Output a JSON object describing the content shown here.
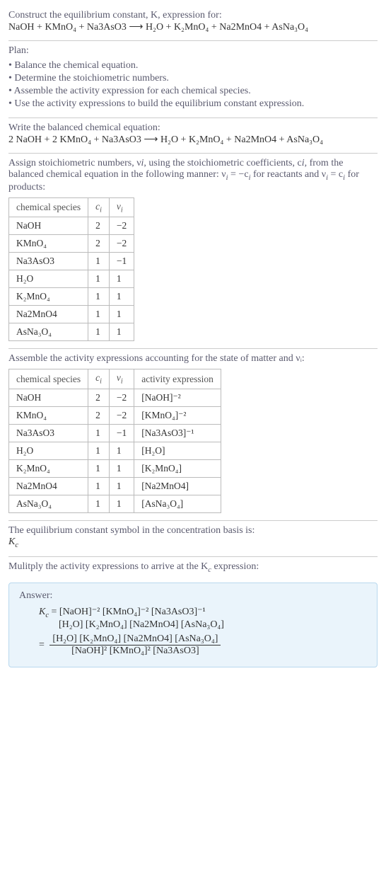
{
  "chart_data": [
    {
      "type": "table",
      "title": "Stoichiometric numbers",
      "columns": [
        "chemical species",
        "c_i",
        "ν_i"
      ],
      "rows": [
        [
          "NaOH",
          2,
          -2
        ],
        [
          "KMnO4",
          2,
          -2
        ],
        [
          "Na3AsO3",
          1,
          -1
        ],
        [
          "H2O",
          1,
          1
        ],
        [
          "K2MnO4",
          1,
          1
        ],
        [
          "Na2MnO4",
          1,
          1
        ],
        [
          "AsNa3O4",
          1,
          1
        ]
      ]
    },
    {
      "type": "table",
      "title": "Activity expressions",
      "columns": [
        "chemical species",
        "c_i",
        "ν_i",
        "activity expression"
      ],
      "rows": [
        [
          "NaOH",
          2,
          -2,
          "[NaOH]^(-2)"
        ],
        [
          "KMnO4",
          2,
          -2,
          "[KMnO4]^(-2)"
        ],
        [
          "Na3AsO3",
          1,
          -1,
          "[Na3AsO3]^(-1)"
        ],
        [
          "H2O",
          1,
          1,
          "[H2O]"
        ],
        [
          "K2MnO4",
          1,
          1,
          "[K2MnO4]"
        ],
        [
          "Na2MnO4",
          1,
          1,
          "[Na2MnO4]"
        ],
        [
          "AsNa3O4",
          1,
          1,
          "[AsNa3O4]"
        ]
      ]
    }
  ],
  "s1": {
    "line1": "Construct the equilibrium constant, K, expression for:",
    "eq": "NaOH + KMnO₄ + Na3AsO3 ⟶ H₂O + K₂MnO₄ + Na2MnO4 + AsNa₃O₄"
  },
  "s2": {
    "title": "Plan:",
    "b1": "• Balance the chemical equation.",
    "b2": "• Determine the stoichiometric numbers.",
    "b3": "• Assemble the activity expression for each chemical species.",
    "b4": "• Use the activity expressions to build the equilibrium constant expression."
  },
  "s3": {
    "title": "Write the balanced chemical equation:",
    "eq": "2 NaOH + 2 KMnO₄ + Na3AsO3 ⟶ H₂O + K₂MnO₄ + Na2MnO4 + AsNa₃O₄"
  },
  "s4": {
    "intro_a": "Assign stoichiometric numbers, ν",
    "intro_b": ", using the stoichiometric coefficients, c",
    "intro_c": ", from the balanced chemical equation in the following manner: ν",
    "intro_d": " = −c",
    "intro_e": " for reactants and ν",
    "intro_f": " = c",
    "intro_g": " for products:",
    "th1": "chemical species",
    "th2": "cᵢ",
    "th3": "νᵢ",
    "r1s": "NaOH",
    "r1c": "2",
    "r1v": "−2",
    "r2s": "KMnO₄",
    "r2c": "2",
    "r2v": "−2",
    "r3s": "Na3AsO3",
    "r3c": "1",
    "r3v": "−1",
    "r4s": "H₂O",
    "r4c": "1",
    "r4v": "1",
    "r5s": "K₂MnO₄",
    "r5c": "1",
    "r5v": "1",
    "r6s": "Na2MnO4",
    "r6c": "1",
    "r6v": "1",
    "r7s": "AsNa₃O₄",
    "r7c": "1",
    "r7v": "1"
  },
  "s5": {
    "intro": "Assemble the activity expressions accounting for the state of matter and νᵢ:",
    "th1": "chemical species",
    "th2": "cᵢ",
    "th3": "νᵢ",
    "th4": "activity expression",
    "r1s": "NaOH",
    "r1c": "2",
    "r1v": "−2",
    "r1a": "[NaOH]⁻²",
    "r2s": "KMnO₄",
    "r2c": "2",
    "r2v": "−2",
    "r2a": "[KMnO₄]⁻²",
    "r3s": "Na3AsO3",
    "r3c": "1",
    "r3v": "−1",
    "r3a": "[Na3AsO3]⁻¹",
    "r4s": "H₂O",
    "r4c": "1",
    "r4v": "1",
    "r4a": "[H₂O]",
    "r5s": "K₂MnO₄",
    "r5c": "1",
    "r5v": "1",
    "r5a": "[K₂MnO₄]",
    "r6s": "Na2MnO4",
    "r6c": "1",
    "r6v": "1",
    "r6a": "[Na2MnO4]",
    "r7s": "AsNa₃O₄",
    "r7c": "1",
    "r7v": "1",
    "r7a": "[AsNa₃O₄]"
  },
  "s6": {
    "line1": "The equilibrium constant symbol in the concentration basis is:",
    "sym": "K",
    "sub": "c"
  },
  "s7": {
    "line1": "Mulitply the activity expressions to arrive at the K",
    "line1b": " expression:"
  },
  "ans": {
    "label": "Answer:",
    "lhs1": "K",
    "lhs1sub": "c",
    "rhs1a": " = [NaOH]⁻² [KMnO₄]⁻² [Na3AsO3]⁻¹",
    "rhs1b": "[H₂O] [K₂MnO₄] [Na2MnO4] [AsNa₃O₄]",
    "eq2": " = ",
    "num": "[H₂O] [K₂MnO₄] [Na2MnO4] [AsNa₃O₄]",
    "den": "[NaOH]² [KMnO₄]² [Na3AsO3]"
  }
}
